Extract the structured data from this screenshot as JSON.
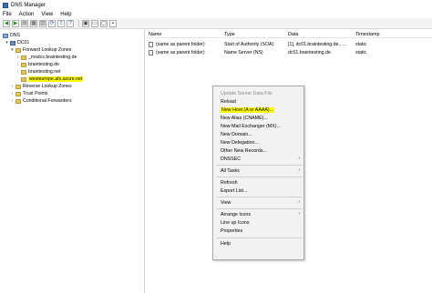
{
  "window": {
    "title": "DNS Manager"
  },
  "menu": [
    "File",
    "Action",
    "View",
    "Help"
  ],
  "tree": {
    "root": "DNS",
    "server": "DC01",
    "forward_zones": "Forward Lookup Zones",
    "zones": [
      "_msdcs.braintesting.de",
      "braintesting.de",
      "braintesting.net",
      "westeurope.afs.azure.net"
    ],
    "reverse_zones": "Reverse Lookup Zones",
    "trust_points": "Trust Points",
    "conditional_forwarders": "Conditional Forwarders"
  },
  "list": {
    "columns": [
      "Name",
      "Type",
      "Data",
      "Timestamp"
    ],
    "rows": [
      {
        "name": "(same as parent folder)",
        "type": "Start of Authority (SOA)",
        "data": "[1], dc01.braintesting.de., ...",
        "timestamp": "static"
      },
      {
        "name": "(same as parent folder)",
        "type": "Name Server (NS)",
        "data": "dc01.braintesting.de.",
        "timestamp": "static"
      }
    ]
  },
  "context_menu": {
    "update_server": "Update Server Data File",
    "reload": "Reload",
    "new_host": "New Host (A or AAAA)...",
    "new_alias": "New Alias (CNAME)...",
    "new_mx": "New Mail Exchanger (MX)...",
    "new_domain": "New Domain...",
    "new_delegation": "New Delegation...",
    "other_records": "Other New Records...",
    "dnssec": "DNSSEC",
    "all_tasks": "All Tasks",
    "refresh": "Refresh",
    "export_list": "Export List...",
    "view": "View",
    "arrange_icons": "Arrange Icons",
    "line_up_icons": "Line up Icons",
    "properties": "Properties",
    "help": "Help"
  },
  "colors": {
    "highlight": "#ffff00"
  }
}
